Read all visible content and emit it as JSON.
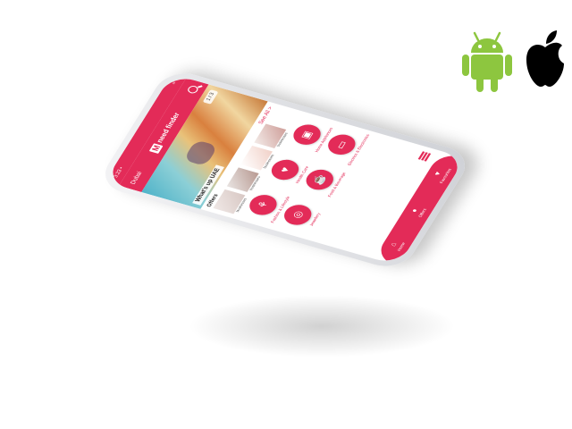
{
  "colors": {
    "brand": "#e32b58",
    "android": "#8dc63f",
    "apple": "#000000"
  },
  "status_bar": {
    "time": "3:23 •"
  },
  "app_bar": {
    "location": "Dubai",
    "brand_mark": "M",
    "brand_name": "need finder",
    "icon": "search-icon"
  },
  "banner": {
    "title": "What's up UAE",
    "counter": "1 / 3"
  },
  "offers_section": {
    "title": "Offers",
    "see_all": "See All >",
    "items": [
      {
        "caption": "businesses"
      },
      {
        "caption": "businesses"
      },
      {
        "caption": "businesses"
      },
      {
        "caption": "businesses"
      }
    ]
  },
  "categories": [
    {
      "label": "Fashion & Lifestyle",
      "icon": "dress-icon",
      "glyph": "⚘"
    },
    {
      "label": "Health Care",
      "icon": "heart-icon",
      "glyph": "♥"
    },
    {
      "label": "Home Appliances",
      "icon": "washing-machine-icon",
      "glyph": "▣"
    },
    {
      "label": "Jewellery",
      "icon": "ring-icon",
      "glyph": "◎"
    },
    {
      "label": "Food & Beverage",
      "icon": "coffee-icon",
      "glyph": "☕"
    },
    {
      "label": "Electrics & Electronics",
      "icon": "devices-icon",
      "glyph": "▭"
    }
  ],
  "bottom_nav": [
    {
      "label": "Home",
      "icon": "home-icon",
      "glyph": "⌂"
    },
    {
      "label": "Offers",
      "icon": "offers-icon",
      "glyph": "●"
    },
    {
      "label": "Favourites",
      "icon": "heart-icon",
      "glyph": "♥"
    }
  ],
  "platforms": [
    {
      "icon": "android-icon"
    },
    {
      "icon": "apple-icon"
    }
  ]
}
